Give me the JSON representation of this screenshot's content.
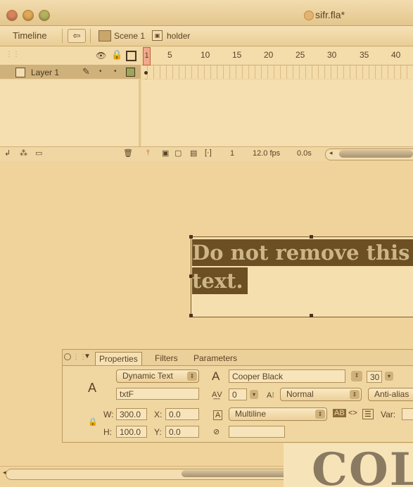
{
  "window": {
    "title": "sifr.fla*"
  },
  "timeline_bar": {
    "label": "Timeline",
    "back_glyph": "⇦",
    "breadcrumb": [
      {
        "label": "Scene 1",
        "icon": "clapper-icon"
      },
      {
        "label": "holder",
        "icon": "symbol-icon"
      }
    ]
  },
  "layers": {
    "header_icons": [
      "eye-icon",
      "lock-icon",
      "outline-icon"
    ],
    "items": [
      {
        "name": "Layer 1",
        "active": true
      }
    ]
  },
  "ruler": {
    "current_frame": "1",
    "ticks": [
      "5",
      "10",
      "15",
      "20",
      "25",
      "30",
      "35",
      "40"
    ]
  },
  "timeline_footer": {
    "current_frame": "1",
    "fps": "12.0 fps",
    "elapsed": "0.0s"
  },
  "stage": {
    "text_line1": "Do not remove this",
    "text_line2": "text."
  },
  "properties": {
    "tabs": [
      "Properties",
      "Filters",
      "Parameters"
    ],
    "active_tab": "Properties",
    "text_type": "Dynamic Text",
    "instance_name": "txtF",
    "font": "Cooper Black",
    "font_size": "30",
    "letter_spacing": "0",
    "position_mode": "Normal",
    "anti_alias": "Anti-alias",
    "line_type": "Multiline",
    "width_label": "W:",
    "width": "300.0",
    "height_label": "H:",
    "height": "100.0",
    "x_label": "X:",
    "x": "0.0",
    "y_label": "Y:",
    "y": "0.0",
    "var_label": "Var:"
  },
  "overlay": {
    "text": "COL"
  }
}
